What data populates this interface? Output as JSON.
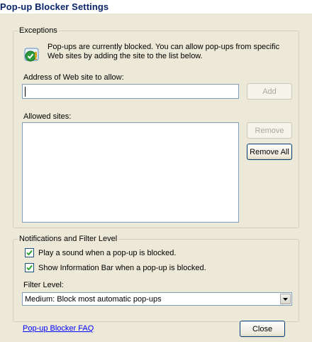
{
  "window": {
    "title": "Pop-up Blocker Settings",
    "close_glyph": "x"
  },
  "exceptions": {
    "legend": "Exceptions",
    "info_line1": "Pop-ups are currently blocked.  You can allow pop-ups from specific",
    "info_line2": "Web sites by adding the site to the list below.",
    "address_label": "Address of Web site to allow:",
    "address_value": "",
    "add_button": "Add",
    "allowed_label": "Allowed sites:",
    "allowed_sites": [],
    "remove_button": "Remove",
    "remove_all_button": "Remove All"
  },
  "notifications": {
    "legend": "Notifications and Filter Level",
    "play_sound_label": "Play a sound when a pop-up is blocked.",
    "play_sound_checked": true,
    "show_infobar_label": "Show Information Bar when a pop-up is blocked.",
    "show_infobar_checked": true,
    "filter_level_label": "Filter Level:",
    "filter_level_value": "Medium: Block most automatic pop-ups"
  },
  "footer": {
    "faq_link": "Pop-up Blocker FAQ",
    "close_button": "Close"
  },
  "icons": {
    "info": "shield-check-warning-icon",
    "dropdown": "chevron-down-icon",
    "check": "check-icon"
  },
  "colors": {
    "accent": "#0a246a",
    "link": "#0000ff",
    "dialog_bg": "#ece9d8",
    "input_border": "#7f9db9"
  }
}
